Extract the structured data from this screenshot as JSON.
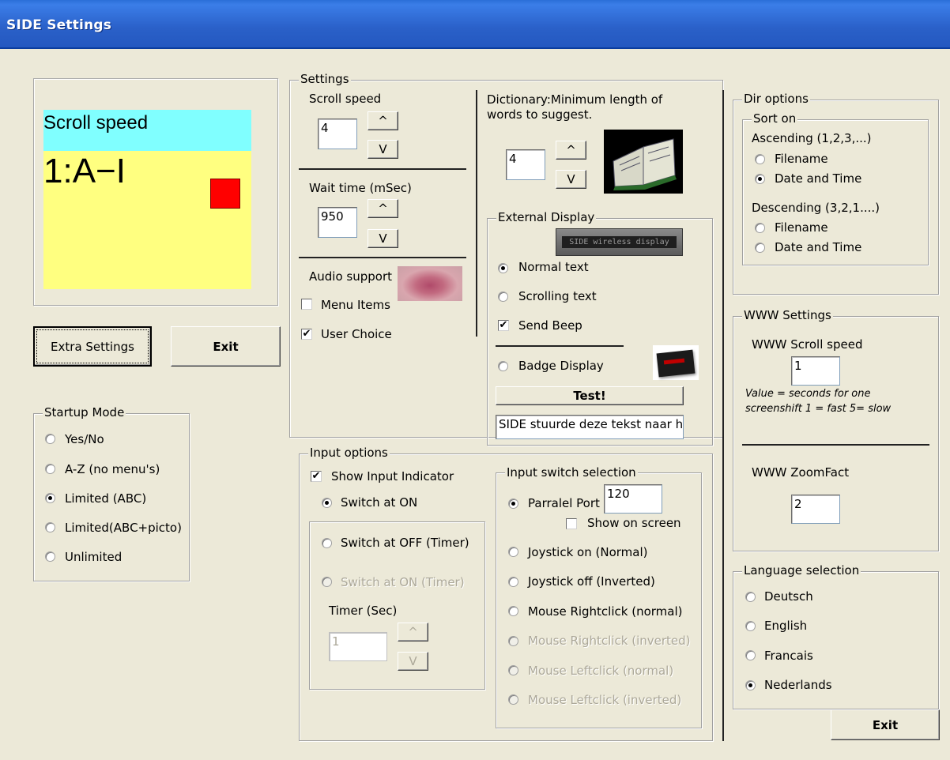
{
  "window": {
    "title": "SIDE Settings"
  },
  "preview": {
    "header": "Scroll speed",
    "value": "1:A−I",
    "header_color": "#80ffff",
    "body_color": "#ffff80",
    "marker_color": "#ff0000"
  },
  "buttons": {
    "extra_settings": "Extra Settings",
    "exit": "Exit",
    "exit_bottom": "Exit",
    "test": "Test!",
    "up": "^",
    "down": "V"
  },
  "startup": {
    "legend": "Startup Mode",
    "options": [
      {
        "label": "Yes/No",
        "checked": false
      },
      {
        "label": "A-Z (no menu's)",
        "checked": false
      },
      {
        "label": "Limited (ABC)",
        "checked": true
      },
      {
        "label": "Limited(ABC+picto)",
        "checked": false
      },
      {
        "label": "Unlimited",
        "checked": false
      }
    ]
  },
  "settings": {
    "legend": "Settings",
    "scroll_speed": {
      "label": "Scroll speed",
      "value": "4"
    },
    "wait_time": {
      "label": "Wait time (mSec)",
      "value": "950"
    },
    "audio": {
      "label": "Audio support",
      "menu_items": "Menu Items",
      "menu_items_checked": false,
      "user_choice": "User Choice",
      "user_choice_checked": true
    },
    "dictionary": {
      "label_line1": "Dictionary:Minimum length of",
      "label_line2": "words to suggest.",
      "value": "4"
    },
    "external": {
      "legend": "External Display",
      "device_text": "SIDE wireless display",
      "normal_text": "Normal text",
      "normal_checked": true,
      "scrolling_text": "Scrolling text",
      "scrolling_checked": false,
      "send_beep": "Send Beep",
      "send_beep_checked": true,
      "badge_display": "Badge Display",
      "badge_checked": false,
      "message": "SIDE stuurde deze tekst naar h"
    }
  },
  "input_options": {
    "legend": "Input options",
    "show_indicator": "Show Input Indicator",
    "show_indicator_checked": true,
    "switch_on": "Switch at ON",
    "switch_off_timer": "Switch at OFF (Timer)",
    "switch_on_timer": "Switch at ON (Timer)",
    "timer_label": "Timer (Sec)",
    "timer_value": "1",
    "switch_selection": {
      "legend": "Input switch selection",
      "parallel_port": "Parralel Port",
      "parallel_value": "120",
      "show_on_screen": "Show on screen",
      "joystick_on": "Joystick on (Normal)",
      "joystick_off": "Joystick off (Inverted)",
      "mouse_right_normal": "Mouse Rightclick (normal)",
      "mouse_right_inverted": "Mouse Rightclick (inverted)",
      "mouse_left_normal": "Mouse Leftclick  (normal)",
      "mouse_left_inverted": "Mouse Leftclick  (inverted)"
    }
  },
  "dir_options": {
    "legend": "Dir options",
    "sort_legend": "Sort on",
    "ascending": "Ascending (1,2,3,...)",
    "asc_filename": "Filename",
    "asc_date": "Date and Time",
    "descending": "Descending (3,2,1....)",
    "desc_filename": "Filename",
    "desc_date": "Date and Time"
  },
  "www": {
    "legend": "WWW Settings",
    "scroll_label": "WWW Scroll speed",
    "scroll_value": "1",
    "note_line1": "Value = seconds for one",
    "note_line2": "screenshift 1 = fast     5= slow",
    "zoom_label": "WWW ZoomFact",
    "zoom_value": "2"
  },
  "language": {
    "legend": "Language selection",
    "options": [
      {
        "label": "Deutsch",
        "checked": false
      },
      {
        "label": "English",
        "checked": false
      },
      {
        "label": "Francais",
        "checked": false
      },
      {
        "label": "Nederlands",
        "checked": true
      }
    ]
  }
}
